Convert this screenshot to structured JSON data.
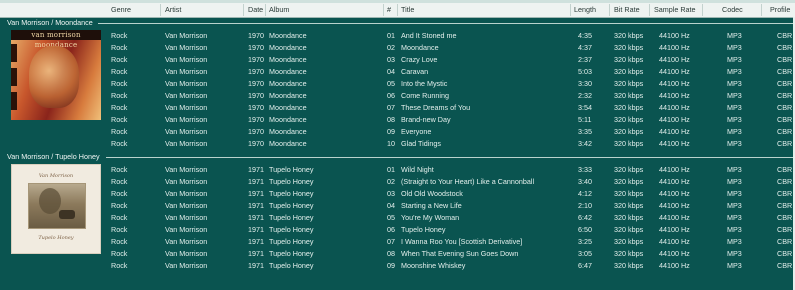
{
  "columns": {
    "genre": "Genre",
    "artist": "Artist",
    "date": "Date",
    "album": "Album",
    "num": "#",
    "title": "Title",
    "length": "Length",
    "bitrate": "Bit Rate",
    "sample": "Sample Rate",
    "codec": "Codec",
    "profile": "Profile"
  },
  "groups": [
    {
      "title": "Van Morrison / Moondance",
      "cover_text": "van morrison moondance",
      "tracks": [
        {
          "genre": "Rock",
          "artist": "Van Morrison",
          "date": "1970",
          "album": "Moondance",
          "num": "01",
          "title": "And It Stoned me",
          "length": "4:35",
          "bitrate": "320 kbps",
          "sample": "44100 Hz",
          "codec": "MP3",
          "profile": "CBR"
        },
        {
          "genre": "Rock",
          "artist": "Van Morrison",
          "date": "1970",
          "album": "Moondance",
          "num": "02",
          "title": "Moondance",
          "length": "4:37",
          "bitrate": "320 kbps",
          "sample": "44100 Hz",
          "codec": "MP3",
          "profile": "CBR"
        },
        {
          "genre": "Rock",
          "artist": "Van Morrison",
          "date": "1970",
          "album": "Moondance",
          "num": "03",
          "title": "Crazy Love",
          "length": "2:37",
          "bitrate": "320 kbps",
          "sample": "44100 Hz",
          "codec": "MP3",
          "profile": "CBR"
        },
        {
          "genre": "Rock",
          "artist": "Van Morrison",
          "date": "1970",
          "album": "Moondance",
          "num": "04",
          "title": "Caravan",
          "length": "5:03",
          "bitrate": "320 kbps",
          "sample": "44100 Hz",
          "codec": "MP3",
          "profile": "CBR"
        },
        {
          "genre": "Rock",
          "artist": "Van Morrison",
          "date": "1970",
          "album": "Moondance",
          "num": "05",
          "title": "Into the Mystic",
          "length": "3:30",
          "bitrate": "320 kbps",
          "sample": "44100 Hz",
          "codec": "MP3",
          "profile": "CBR"
        },
        {
          "genre": "Rock",
          "artist": "Van Morrison",
          "date": "1970",
          "album": "Moondance",
          "num": "06",
          "title": "Come Running",
          "length": "2:32",
          "bitrate": "320 kbps",
          "sample": "44100 Hz",
          "codec": "MP3",
          "profile": "CBR"
        },
        {
          "genre": "Rock",
          "artist": "Van Morrison",
          "date": "1970",
          "album": "Moondance",
          "num": "07",
          "title": "These Dreams of You",
          "length": "3:54",
          "bitrate": "320 kbps",
          "sample": "44100 Hz",
          "codec": "MP3",
          "profile": "CBR"
        },
        {
          "genre": "Rock",
          "artist": "Van Morrison",
          "date": "1970",
          "album": "Moondance",
          "num": "08",
          "title": "Brand-new Day",
          "length": "5:11",
          "bitrate": "320 kbps",
          "sample": "44100 Hz",
          "codec": "MP3",
          "profile": "CBR"
        },
        {
          "genre": "Rock",
          "artist": "Van Morrison",
          "date": "1970",
          "album": "Moondance",
          "num": "09",
          "title": "Everyone",
          "length": "3:35",
          "bitrate": "320 kbps",
          "sample": "44100 Hz",
          "codec": "MP3",
          "profile": "CBR"
        },
        {
          "genre": "Rock",
          "artist": "Van Morrison",
          "date": "1970",
          "album": "Moondance",
          "num": "10",
          "title": "Glad Tidings",
          "length": "3:42",
          "bitrate": "320 kbps",
          "sample": "44100 Hz",
          "codec": "MP3",
          "profile": "CBR"
        }
      ]
    },
    {
      "title": "Van Morrison / Tupelo Honey",
      "cover_text": "Van Morrison",
      "cover_subtext": "Tupelo Honey",
      "tracks": [
        {
          "genre": "Rock",
          "artist": "Van Morrison",
          "date": "1971",
          "album": "Tupelo Honey",
          "num": "01",
          "title": "Wild Night",
          "length": "3:33",
          "bitrate": "320 kbps",
          "sample": "44100 Hz",
          "codec": "MP3",
          "profile": "CBR"
        },
        {
          "genre": "Rock",
          "artist": "Van Morrison",
          "date": "1971",
          "album": "Tupelo Honey",
          "num": "02",
          "title": "(Straight to Your Heart) Like a Cannonball",
          "length": "3:40",
          "bitrate": "320 kbps",
          "sample": "44100 Hz",
          "codec": "MP3",
          "profile": "CBR"
        },
        {
          "genre": "Rock",
          "artist": "Van Morrison",
          "date": "1971",
          "album": "Tupelo Honey",
          "num": "03",
          "title": "Old Old Woodstock",
          "length": "4:12",
          "bitrate": "320 kbps",
          "sample": "44100 Hz",
          "codec": "MP3",
          "profile": "CBR"
        },
        {
          "genre": "Rock",
          "artist": "Van Morrison",
          "date": "1971",
          "album": "Tupelo Honey",
          "num": "04",
          "title": "Starting a New Life",
          "length": "2:10",
          "bitrate": "320 kbps",
          "sample": "44100 Hz",
          "codec": "MP3",
          "profile": "CBR"
        },
        {
          "genre": "Rock",
          "artist": "Van Morrison",
          "date": "1971",
          "album": "Tupelo Honey",
          "num": "05",
          "title": "You're My Woman",
          "length": "6:42",
          "bitrate": "320 kbps",
          "sample": "44100 Hz",
          "codec": "MP3",
          "profile": "CBR"
        },
        {
          "genre": "Rock",
          "artist": "Van Morrison",
          "date": "1971",
          "album": "Tupelo Honey",
          "num": "06",
          "title": "Tupelo Honey",
          "length": "6:50",
          "bitrate": "320 kbps",
          "sample": "44100 Hz",
          "codec": "MP3",
          "profile": "CBR"
        },
        {
          "genre": "Rock",
          "artist": "Van Morrison",
          "date": "1971",
          "album": "Tupelo Honey",
          "num": "07",
          "title": "I Wanna Roo You [Scottish Derivative]",
          "length": "3:25",
          "bitrate": "320 kbps",
          "sample": "44100 Hz",
          "codec": "MP3",
          "profile": "CBR"
        },
        {
          "genre": "Rock",
          "artist": "Van Morrison",
          "date": "1971",
          "album": "Tupelo Honey",
          "num": "08",
          "title": "When That Evening Sun Goes Down",
          "length": "3:05",
          "bitrate": "320 kbps",
          "sample": "44100 Hz",
          "codec": "MP3",
          "profile": "CBR"
        },
        {
          "genre": "Rock",
          "artist": "Van Morrison",
          "date": "1971",
          "album": "Tupelo Honey",
          "num": "09",
          "title": "Moonshine Whiskey",
          "length": "6:47",
          "bitrate": "320 kbps",
          "sample": "44100 Hz",
          "codec": "MP3",
          "profile": "CBR"
        }
      ]
    }
  ]
}
